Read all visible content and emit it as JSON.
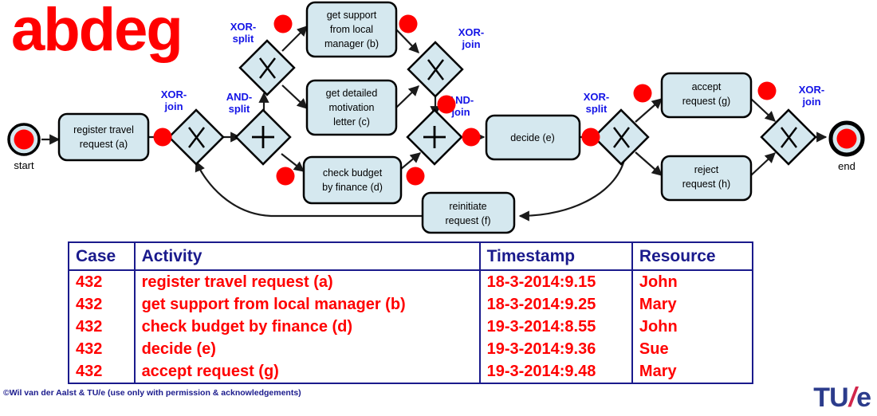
{
  "trace": {
    "title": "abdeg"
  },
  "diagram": {
    "start_label": "start",
    "end_label": "end",
    "activities": [
      {
        "id": "a",
        "lines": [
          "register travel",
          "request (a)"
        ]
      },
      {
        "id": "b",
        "lines": [
          "get support",
          "from local",
          "manager (b)"
        ]
      },
      {
        "id": "c",
        "lines": [
          "get detailed",
          "motivation",
          "letter (c)"
        ]
      },
      {
        "id": "d",
        "lines": [
          "check budget",
          "by finance (d)"
        ]
      },
      {
        "id": "e",
        "lines": [
          "decide (e)"
        ]
      },
      {
        "id": "f",
        "lines": [
          "reinitiate",
          "request (f)"
        ]
      },
      {
        "id": "g",
        "lines": [
          "accept",
          "request (g)"
        ]
      },
      {
        "id": "h",
        "lines": [
          "reject",
          "request (h)"
        ]
      }
    ],
    "gateways": [
      {
        "id": "xor-join-1",
        "type": "XOR",
        "lines": [
          "XOR-",
          "join"
        ]
      },
      {
        "id": "and-split-1",
        "type": "AND",
        "lines": [
          "AND-",
          "split"
        ]
      },
      {
        "id": "xor-split-1",
        "type": "XOR",
        "lines": [
          "XOR-",
          "split"
        ]
      },
      {
        "id": "xor-join-2",
        "type": "XOR",
        "lines": [
          "XOR-",
          "join"
        ]
      },
      {
        "id": "and-join-1",
        "type": "AND",
        "lines": [
          "AND-",
          "join"
        ]
      },
      {
        "id": "xor-split-2",
        "type": "XOR",
        "lines": [
          "XOR-",
          "split"
        ]
      },
      {
        "id": "xor-join-3",
        "type": "XOR",
        "lines": [
          "XOR-",
          "join"
        ]
      }
    ],
    "colors": {
      "node_fill": "#d5e8ef",
      "node_stroke": "#000000",
      "token": "#ff0000",
      "gateway_label": "#1414e6"
    }
  },
  "event_log": {
    "columns": [
      "Case",
      "Activity",
      "Timestamp",
      "Resource"
    ],
    "rows": [
      {
        "case": "432",
        "activity": "register travel request (a)",
        "timestamp": "18-3-2014:9.15",
        "resource": "John"
      },
      {
        "case": "432",
        "activity": "get support from local manager (b)",
        "timestamp": "18-3-2014:9.25",
        "resource": "Mary"
      },
      {
        "case": "432",
        "activity": "check budget by finance (d)",
        "timestamp": "19-3-2014:8.55",
        "resource": "John"
      },
      {
        "case": "432",
        "activity": "decide (e)",
        "timestamp": "19-3-2014:9.36",
        "resource": "Sue"
      },
      {
        "case": "432",
        "activity": "accept request (g)",
        "timestamp": "19-3-2014:9.48",
        "resource": "Mary"
      }
    ]
  },
  "footer": {
    "copyright": "©Wil van der Aalst & TU/e (use only with permission & acknowledgements)",
    "logo_tu": "TU",
    "logo_slash": "/",
    "logo_e": "e"
  }
}
